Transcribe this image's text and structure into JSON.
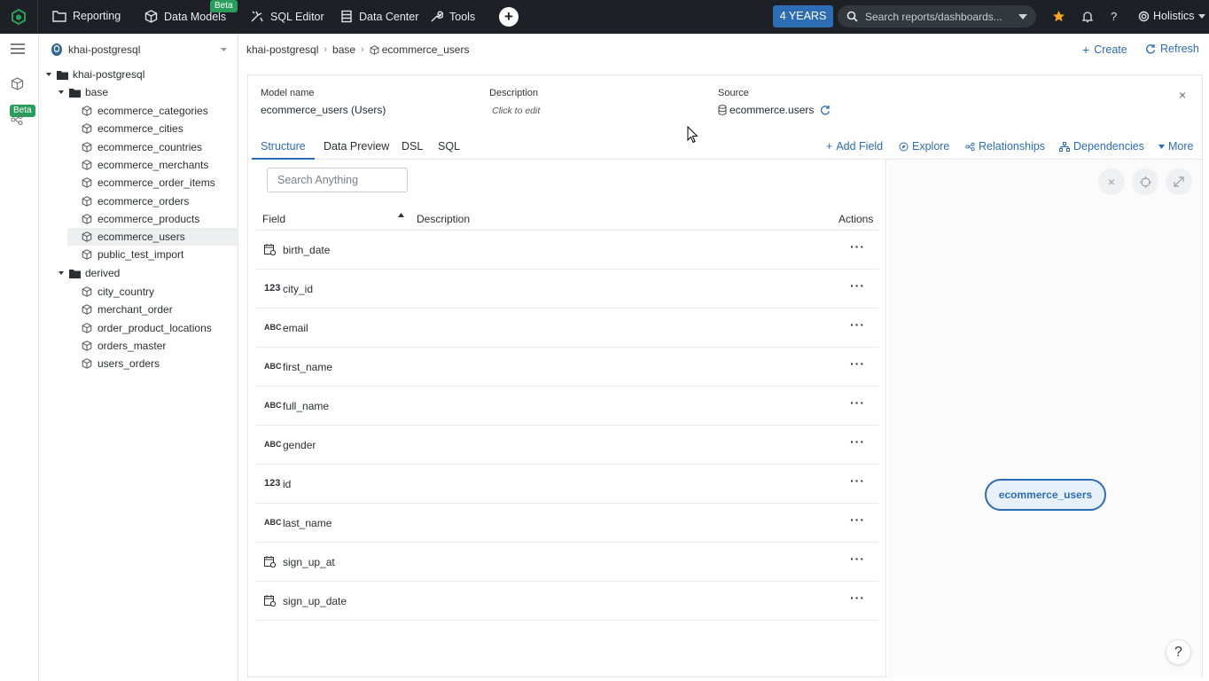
{
  "topbar": {
    "nav": [
      {
        "label": "Reporting",
        "icon": "folder-icon"
      },
      {
        "label": "Data Models",
        "icon": "cube-icon",
        "badge": "Beta"
      },
      {
        "label": "SQL Editor",
        "icon": "sql-editor-icon"
      },
      {
        "label": "Data Center",
        "icon": "data-center-icon"
      },
      {
        "label": "Tools",
        "icon": "wrench-icon"
      }
    ],
    "years_label": "4 YEARS",
    "search_placeholder": "Search reports/dashboards...",
    "user_label": "Holistics"
  },
  "rail": {
    "beta_label": "Beta"
  },
  "tree": {
    "datasource": "khai-postgresql",
    "root": "khai-postgresql",
    "folders": [
      {
        "name": "base",
        "items": [
          "ecommerce_categories",
          "ecommerce_cities",
          "ecommerce_countries",
          "ecommerce_merchants",
          "ecommerce_order_items",
          "ecommerce_orders",
          "ecommerce_products",
          "ecommerce_users",
          "public_test_import"
        ]
      },
      {
        "name": "derived",
        "items": [
          "city_country",
          "merchant_order",
          "order_product_locations",
          "orders_master",
          "users_orders"
        ]
      }
    ],
    "selected": "ecommerce_users"
  },
  "breadcrumb": {
    "items": [
      "khai-postgresql",
      "base",
      "ecommerce_users"
    ]
  },
  "header_actions": {
    "create": "Create",
    "refresh": "Refresh"
  },
  "model": {
    "name_label": "Model name",
    "name_value": "ecommerce_users (Users)",
    "desc_label": "Description",
    "desc_value": "Click to edit",
    "source_label": "Source",
    "source_value": "ecommerce.users"
  },
  "tabs": [
    "Structure",
    "Data Preview",
    "DSL",
    "SQL"
  ],
  "toolbar": {
    "add_field": "Add Field",
    "explore": "Explore",
    "relationships": "Relationships",
    "dependencies": "Dependencies",
    "more": "More"
  },
  "structure": {
    "search_placeholder": "Search Anything",
    "columns": {
      "field": "Field",
      "description": "Description",
      "actions": "Actions"
    },
    "fields": [
      {
        "name": "birth_date",
        "type": "date",
        "icon": "calendar-icon"
      },
      {
        "name": "city_id",
        "type": "number",
        "icon": "123"
      },
      {
        "name": "email",
        "type": "text",
        "icon": "ABC"
      },
      {
        "name": "first_name",
        "type": "text",
        "icon": "ABC"
      },
      {
        "name": "full_name",
        "type": "text",
        "icon": "ABC"
      },
      {
        "name": "gender",
        "type": "text",
        "icon": "ABC"
      },
      {
        "name": "id",
        "type": "number",
        "icon": "123"
      },
      {
        "name": "last_name",
        "type": "text",
        "icon": "ABC"
      },
      {
        "name": "sign_up_at",
        "type": "date",
        "icon": "calendar-icon"
      },
      {
        "name": "sign_up_date",
        "type": "date",
        "icon": "calendar-icon"
      }
    ]
  },
  "graph": {
    "node_label": "ecommerce_users"
  },
  "help_label": "?",
  "colors": {
    "topbar": "#1d2125",
    "accent": "#2c6db3",
    "beta": "#2a9d5c"
  }
}
